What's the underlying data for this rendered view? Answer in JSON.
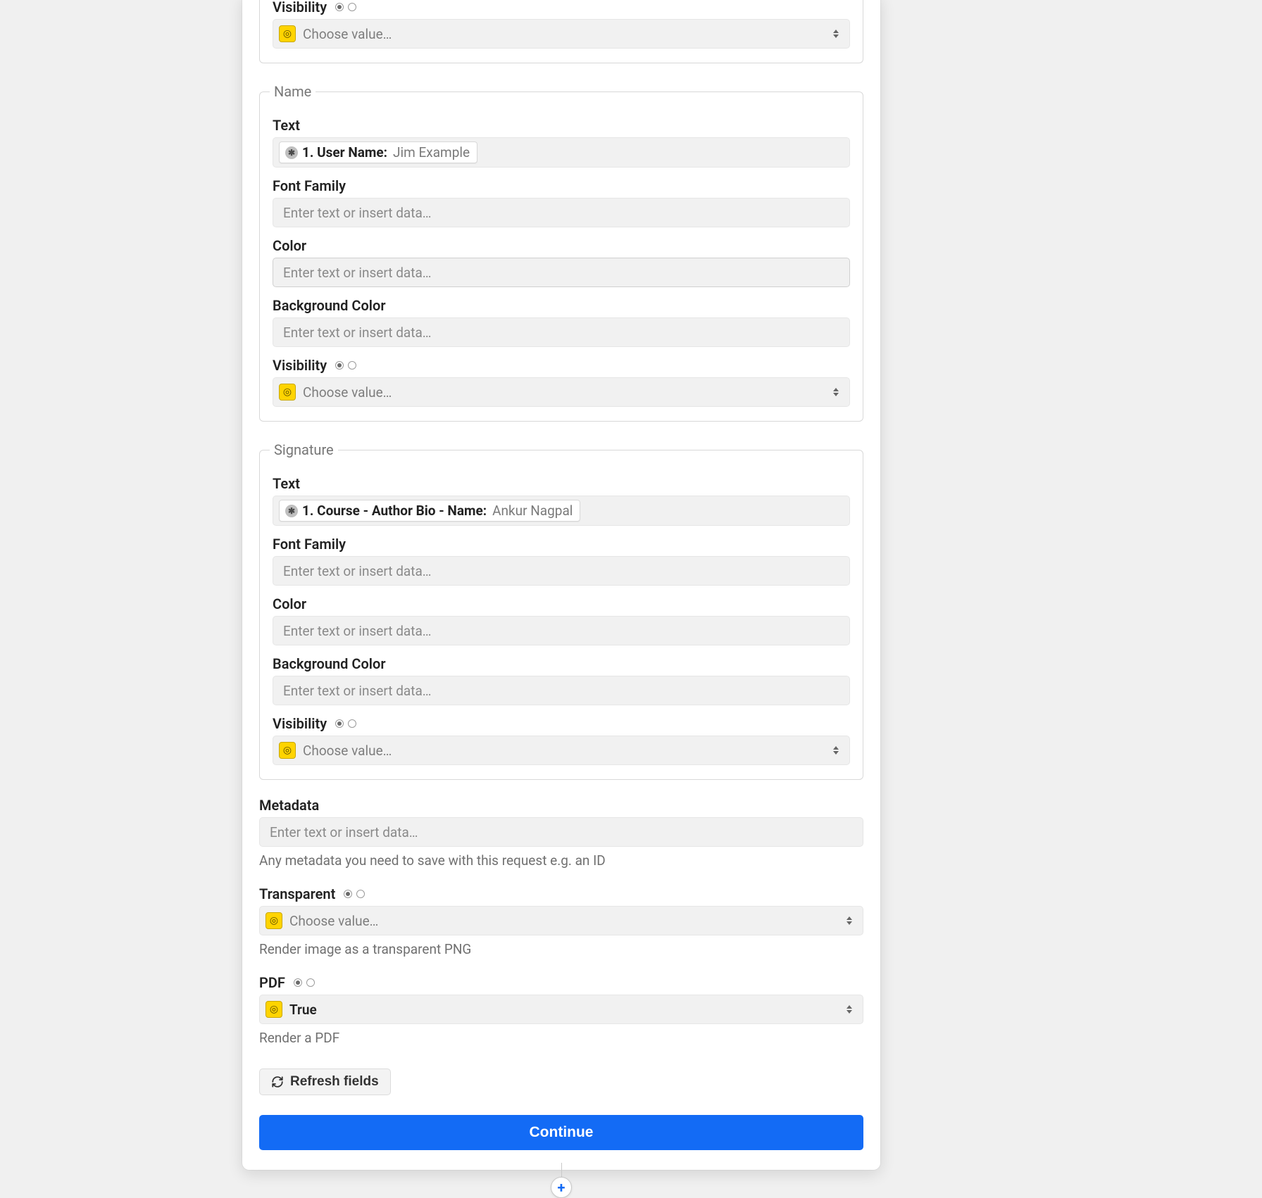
{
  "placeholders": {
    "text_input": "Enter text or insert data…",
    "choose_value": "Choose value…"
  },
  "top_group": {
    "visibility_label": "Visibility"
  },
  "name_group": {
    "legend": "Name",
    "text_label": "Text",
    "text_token_label": "1. User Name:",
    "text_token_value": "Jim Example",
    "font_family_label": "Font Family",
    "color_label": "Color",
    "background_color_label": "Background Color",
    "visibility_label": "Visibility"
  },
  "signature_group": {
    "legend": "Signature",
    "text_label": "Text",
    "text_token_label": "1. Course - Author Bio - Name:",
    "text_token_value": "Ankur Nagpal",
    "font_family_label": "Font Family",
    "color_label": "Color",
    "background_color_label": "Background Color",
    "visibility_label": "Visibility"
  },
  "metadata": {
    "label": "Metadata",
    "helper": "Any metadata you need to save with this request e.g. an ID"
  },
  "transparent": {
    "label": "Transparent",
    "helper": "Render image as a transparent PNG"
  },
  "pdf": {
    "label": "PDF",
    "value": "True",
    "helper": "Render a PDF"
  },
  "buttons": {
    "refresh": "Refresh fields",
    "continue": "Continue"
  },
  "icons": {
    "chip": "⊕",
    "plus": "+"
  }
}
